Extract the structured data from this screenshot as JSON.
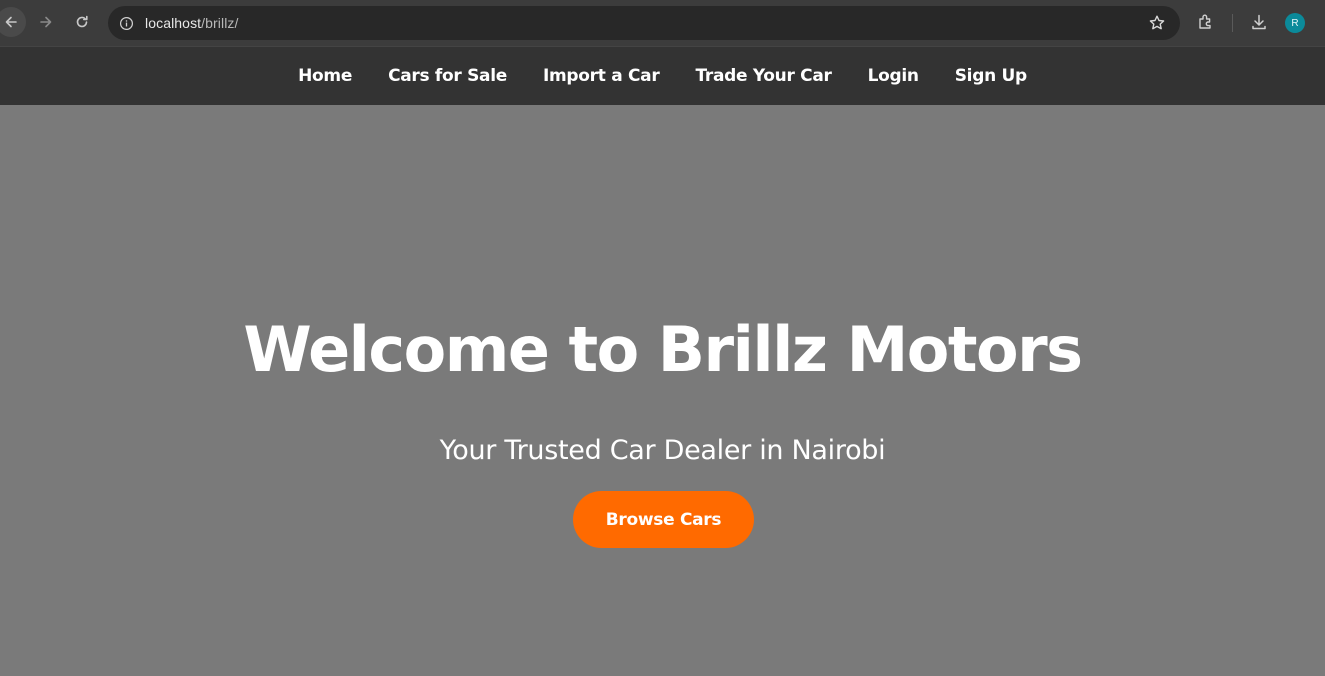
{
  "browser": {
    "url_host": "localhost",
    "url_path": "/brillz/",
    "avatar_initial": "R"
  },
  "nav": {
    "items": [
      {
        "label": "Home"
      },
      {
        "label": "Cars for Sale"
      },
      {
        "label": "Import a Car"
      },
      {
        "label": "Trade Your Car"
      },
      {
        "label": "Login"
      },
      {
        "label": "Sign Up"
      }
    ]
  },
  "hero": {
    "title": "Welcome to Brillz Motors",
    "subtitle": "Your Trusted Car Dealer in Nairobi",
    "cta_label": "Browse Cars"
  },
  "colors": {
    "accent": "#ff6a00",
    "nav_bg": "#333333",
    "hero_bg": "#7a7a7a"
  },
  "icons": [
    "back-arrow-icon",
    "forward-arrow-icon",
    "reload-icon",
    "site-info-icon",
    "bookmark-star-icon",
    "extensions-icon",
    "download-icon"
  ]
}
